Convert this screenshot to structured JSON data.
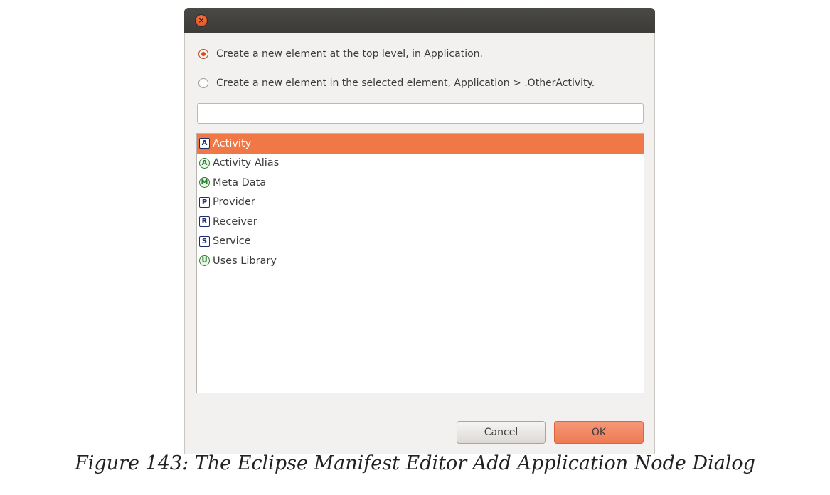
{
  "dialog": {
    "close_glyph": "×",
    "options": [
      {
        "label": "Create a new element at the top level, in Application.",
        "checked": true
      },
      {
        "label": "Create a new element in the selected element, Application > .OtherActivity.",
        "checked": false
      }
    ],
    "filter": {
      "value": "",
      "placeholder": ""
    },
    "list_items": [
      {
        "letter": "A",
        "icon": "activity-icon",
        "shape": "square",
        "label": "Activity",
        "selected": true
      },
      {
        "letter": "A",
        "icon": "activity-alias-icon",
        "shape": "circle",
        "label": "Activity Alias",
        "selected": false
      },
      {
        "letter": "M",
        "icon": "meta-data-icon",
        "shape": "circle",
        "label": "Meta Data",
        "selected": false
      },
      {
        "letter": "P",
        "icon": "provider-icon",
        "shape": "square",
        "label": "Provider",
        "selected": false
      },
      {
        "letter": "R",
        "icon": "receiver-icon",
        "shape": "square",
        "label": "Receiver",
        "selected": false
      },
      {
        "letter": "S",
        "icon": "service-icon",
        "shape": "square",
        "label": "Service",
        "selected": false
      },
      {
        "letter": "U",
        "icon": "uses-library-icon",
        "shape": "circle",
        "label": "Uses Library",
        "selected": false
      }
    ],
    "buttons": {
      "cancel": "Cancel",
      "ok": "OK"
    }
  },
  "caption": "Figure 143: The Eclipse Manifest Editor Add Application Node Dialog",
  "colors": {
    "accent": "#f07746",
    "titlebar": "#3c3b37",
    "ok_button": "#ee7b54"
  }
}
